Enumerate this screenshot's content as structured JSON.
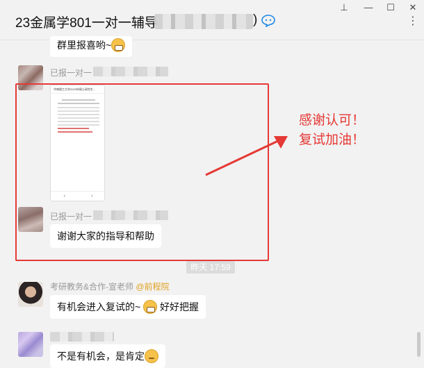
{
  "window": {
    "title": "23金属学801一对一辅导",
    "title_suffix": ")",
    "pin": "⊥",
    "minimize": "—",
    "maximize": "☐",
    "close": "✕",
    "more": "⋮"
  },
  "messages": [
    {
      "text": "群里报喜哟~"
    },
    {
      "sender_prefix": "已报一对一"
    },
    {
      "doc_header": "华南理工大学2023年硕士研究生..."
    },
    {
      "sender_prefix": "已报一对一",
      "text": "谢谢大家的指导和帮助"
    },
    {
      "sender": "考研教务&合作-宣老师",
      "tag": "@前程院",
      "text": "有机会进入复试的~",
      "text_after": "好好把握"
    },
    {
      "text": "不是有机会，是肯定"
    }
  ],
  "time_divider": "昨天 17:59",
  "annotation": {
    "line1": "感谢认可！",
    "line2": "复试加油！",
    "color": "#e53935"
  },
  "colors": {
    "highlight": "#e53935",
    "tag": "#e0a020"
  },
  "icons": {
    "chat": "chat-bubble-icon",
    "emoji_grin": "grin-emoji-icon",
    "emoji_think": "thinking-emoji-icon"
  }
}
